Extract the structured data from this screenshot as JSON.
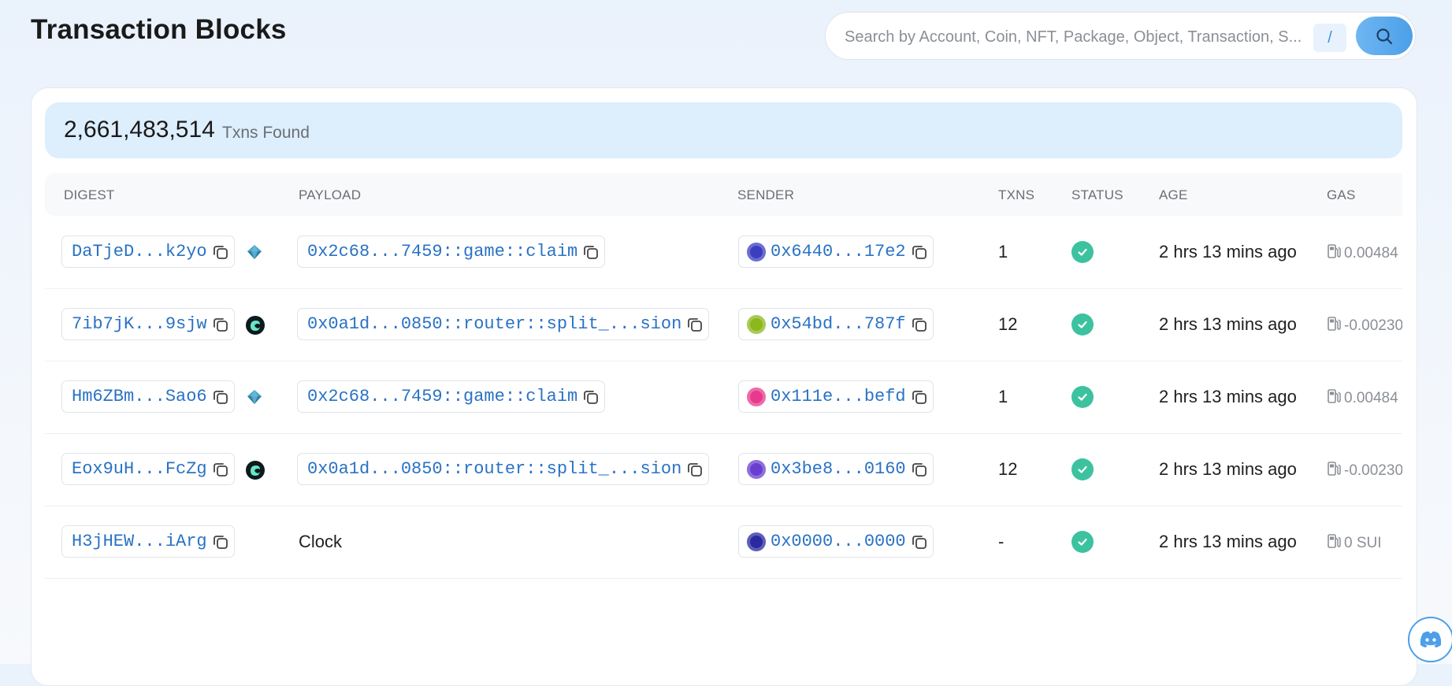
{
  "page": {
    "title": "Transaction Blocks"
  },
  "search": {
    "placeholder": "Search by Account, Coin, NFT, Package, Object, Transaction, S...",
    "shortcut": "/"
  },
  "summary": {
    "count": "2,661,483,514",
    "label": "Txns Found"
  },
  "columns": [
    "DIGEST",
    "PAYLOAD",
    "SENDER",
    "TXNS",
    "STATUS",
    "AGE",
    "GAS"
  ],
  "rows": [
    {
      "digest": "DaTjeD...k2yo",
      "protocol_icon": "diamond-protocol-icon",
      "payload": "0x2c68...7459::game::claim",
      "payload_is_link": true,
      "sender": "0x6440...17e2",
      "avatar_color": "#3b3fbf",
      "txns": "1",
      "status": "success",
      "age": "2 hrs 13 mins ago",
      "gas": "0.00484"
    },
    {
      "digest": "7ib7jK...9sjw",
      "protocol_icon": "cetus-protocol-icon",
      "payload": "0x0a1d...0850::router::split_...sion",
      "payload_is_link": true,
      "sender": "0x54bd...787f",
      "avatar_color": "#8bb81d",
      "txns": "12",
      "status": "success",
      "age": "2 hrs 13 mins ago",
      "gas": "-0.00230"
    },
    {
      "digest": "Hm6ZBm...Sao6",
      "protocol_icon": "diamond-protocol-icon",
      "payload": "0x2c68...7459::game::claim",
      "payload_is_link": true,
      "sender": "0x111e...befd",
      "avatar_color": "#e83a8d",
      "txns": "1",
      "status": "success",
      "age": "2 hrs 13 mins ago",
      "gas": "0.00484"
    },
    {
      "digest": "Eox9uH...FcZg",
      "protocol_icon": "cetus-protocol-icon",
      "payload": "0x0a1d...0850::router::split_...sion",
      "payload_is_link": true,
      "sender": "0x3be8...0160",
      "avatar_color": "#6a3fd0",
      "txns": "12",
      "status": "success",
      "age": "2 hrs 13 mins ago",
      "gas": "-0.00230"
    },
    {
      "digest": "H3jHEW...iArg",
      "protocol_icon": "",
      "payload": "Clock",
      "payload_is_link": false,
      "sender": "0x0000...0000",
      "avatar_color": "#2a2aa0",
      "txns": "-",
      "status": "success",
      "age": "2 hrs 13 mins ago",
      "gas": "0 SUI"
    }
  ],
  "colors": {
    "accent": "#4c9fe8",
    "link": "#2a72c4",
    "success": "#3cc29f"
  }
}
